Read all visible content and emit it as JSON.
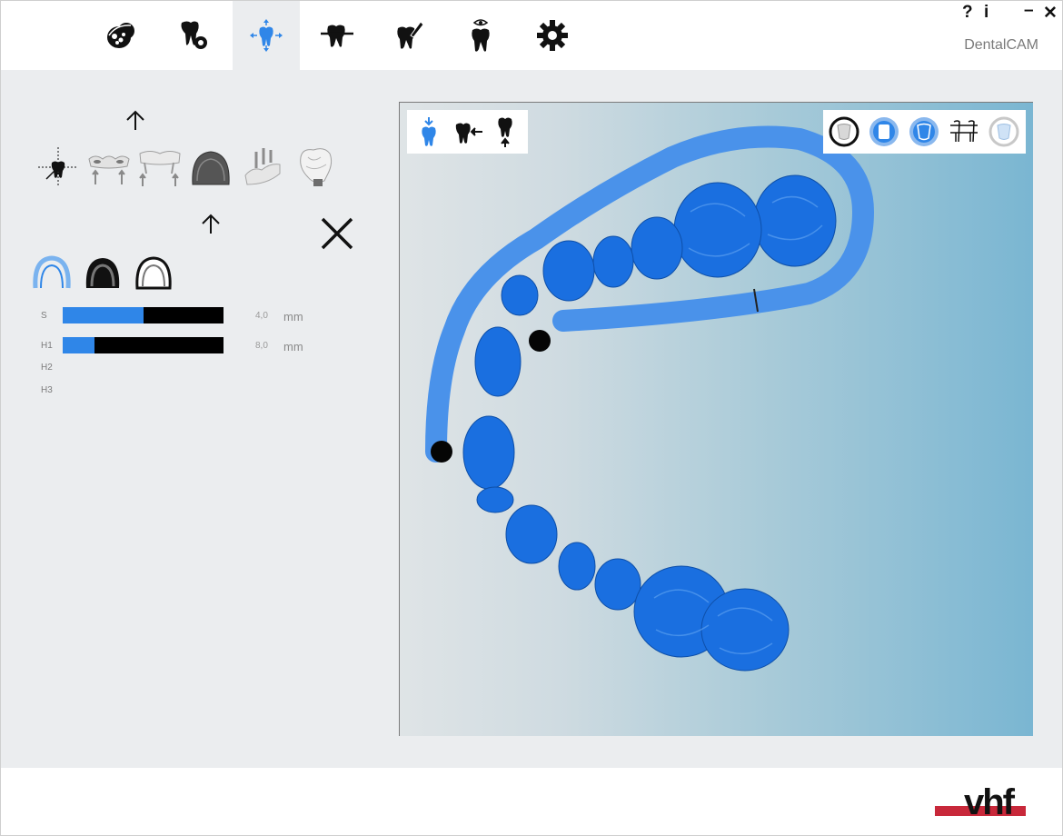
{
  "app": {
    "title": "DentalCAM",
    "help_label": "?",
    "info_label": "i",
    "minimize_label": "–",
    "close_label": "✕"
  },
  "toolbar": {
    "tools": [
      {
        "name": "model-select-tool",
        "icon": "jaw-model-icon"
      },
      {
        "name": "tooth-analysis-tool",
        "icon": "tooth-gear-icon"
      },
      {
        "name": "position-tool",
        "icon": "tooth-move-icon",
        "active": true
      },
      {
        "name": "connector-tool",
        "icon": "tooth-line-icon"
      },
      {
        "name": "tooth-edit-tool",
        "icon": "tooth-pen-icon"
      },
      {
        "name": "preview-tool",
        "icon": "tooth-eye-icon"
      },
      {
        "name": "settings-tool",
        "icon": "gear-icon"
      }
    ],
    "active_color": "#2f86e8"
  },
  "left_panel": {
    "object_types": [
      "coordinate-origin-icon",
      "bridge-abutment-icon",
      "bridge-frame-icon",
      "jaw-arch-icon",
      "implant-bridge-icon",
      "single-crown-icon"
    ],
    "arch_modes": [
      "arch-outline-blue-icon",
      "arch-filled-black-icon",
      "arch-outline-black-icon"
    ],
    "sliders": [
      {
        "label": "S",
        "value": "4,0",
        "unit": "mm",
        "fraction": 0.5
      },
      {
        "label": "H1",
        "value": "8,0",
        "unit": "mm",
        "fraction": 0.2
      }
    ],
    "extra_labels": [
      "H2",
      "H3"
    ]
  },
  "viewport": {
    "left_toolbar": [
      "tooth-down-arrow-icon",
      "tooth-side-arrow-icon",
      "tooth-up-arrow-icon"
    ],
    "right_toolbar": [
      "crown-ring-icon",
      "crown-square-icon",
      "crown-round-icon",
      "bridge-view-icon",
      "crown-faded-icon"
    ],
    "colors": {
      "model": "#1a6fe0",
      "margin": "#4a92ea",
      "pin": "#050505"
    }
  },
  "footer": {
    "brand": "vhf",
    "brand_color": "#c8283a"
  }
}
